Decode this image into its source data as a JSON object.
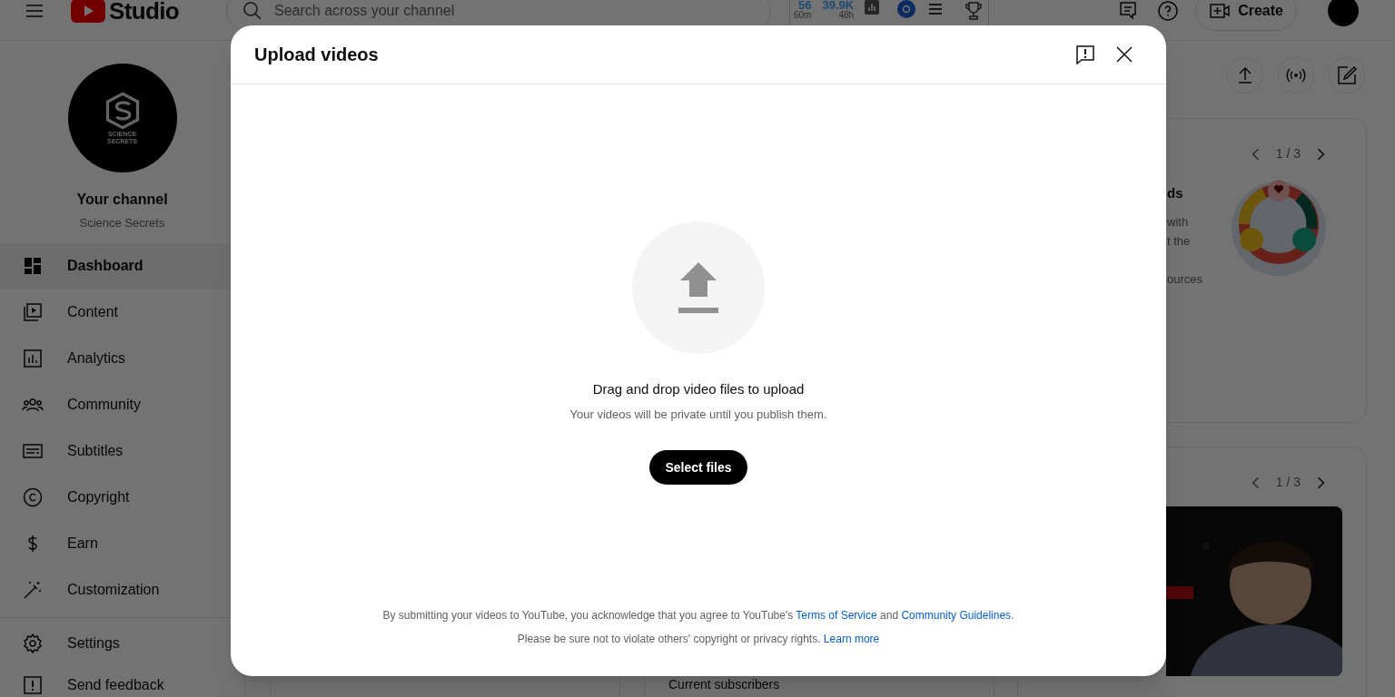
{
  "header": {
    "logo_text": "Studio",
    "search": {
      "placeholder": "Search across your channel"
    },
    "stats": [
      {
        "value": "56",
        "period": "60m"
      },
      {
        "value": "39.9K",
        "period": "48h"
      }
    ],
    "create_label": "Create"
  },
  "channel": {
    "logo_lines": [
      "SCIENCE",
      "SECRETS"
    ],
    "title": "Your channel",
    "name": "Science Secrets"
  },
  "sidebar": {
    "items": [
      {
        "label": "Dashboard",
        "selected": true
      },
      {
        "label": "Content",
        "selected": false
      },
      {
        "label": "Analytics",
        "selected": false
      },
      {
        "label": "Community",
        "selected": false
      },
      {
        "label": "Subtitles",
        "selected": false
      },
      {
        "label": "Copyright",
        "selected": false
      },
      {
        "label": "Earn",
        "selected": false
      },
      {
        "label": "Customization",
        "selected": false
      }
    ],
    "footer_items": [
      {
        "label": "Settings"
      },
      {
        "label": "Send feedback"
      }
    ]
  },
  "cards": [
    {
      "pager": "1 / 3",
      "heading": "ds",
      "lines": [
        "with",
        "t the",
        "ources"
      ]
    },
    {
      "pager": "1 / 3"
    }
  ],
  "bottom_card": {
    "label": "Current subscribers"
  },
  "dialog": {
    "title": "Upload videos",
    "prompt": "Drag and drop video files to upload",
    "note": "Your videos will be private until you publish them.",
    "button": "Select files",
    "legal": [
      [
        {
          "kind": "text",
          "text": "By submitting your videos to YouTube, you acknowledge that you agree to YouTube's "
        },
        {
          "kind": "link",
          "text": "Terms of Service"
        },
        {
          "kind": "text",
          "text": " and "
        },
        {
          "kind": "link",
          "text": "Community Guidelines"
        },
        {
          "kind": "text",
          "text": "."
        }
      ],
      [
        {
          "kind": "text",
          "text": "Please be sure not to violate others' copyright or privacy rights. "
        },
        {
          "kind": "link",
          "text": "Learn more"
        }
      ]
    ]
  }
}
